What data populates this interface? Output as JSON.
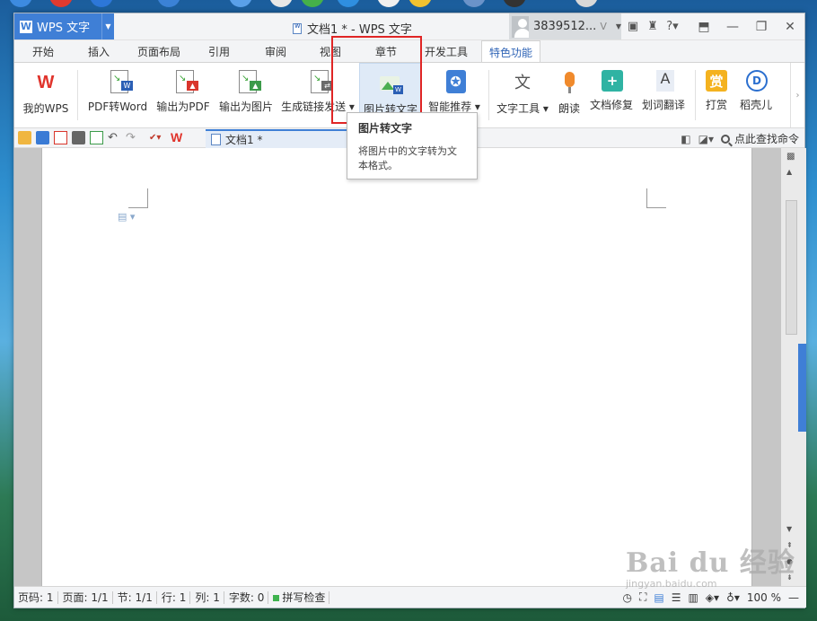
{
  "app": {
    "menu_label": "WPS 文字",
    "logo_letter": "W",
    "window_title": "文档1 * - WPS 文字",
    "user_name": "3839512...",
    "user_level": "V"
  },
  "tabs": [
    {
      "label": "开始"
    },
    {
      "label": "插入"
    },
    {
      "label": "页面布局"
    },
    {
      "label": "引用"
    },
    {
      "label": "审阅"
    },
    {
      "label": "视图"
    },
    {
      "label": "章节"
    },
    {
      "label": "开发工具"
    },
    {
      "label": "特色功能",
      "active": true
    }
  ],
  "ribbon": {
    "buttons": [
      {
        "label": "我的WPS",
        "icon": "wps-logo-icon"
      },
      {
        "label": "PDF转Word",
        "icon": "pdf-to-word-icon"
      },
      {
        "label": "输出为PDF",
        "icon": "export-pdf-icon"
      },
      {
        "label": "输出为图片",
        "icon": "export-image-icon"
      },
      {
        "label": "生成链接发送",
        "icon": "share-link-icon"
      },
      {
        "label": "图片转文字",
        "icon": "image-to-text-icon"
      },
      {
        "label": "智能推荐",
        "icon": "smart-recommend-icon"
      },
      {
        "label": "文字工具",
        "icon": "text-tools-icon"
      },
      {
        "label": "朗读",
        "icon": "microphone-icon"
      },
      {
        "label": "文档修复",
        "icon": "document-repair-icon"
      },
      {
        "label": "划词翻译",
        "icon": "translate-icon"
      },
      {
        "label": "打赏",
        "icon": "reward-icon"
      },
      {
        "label": "稻壳儿",
        "icon": "docer-icon"
      }
    ],
    "reward_glyph": "赏",
    "translate_glyph": "A"
  },
  "quick_access": {
    "document_tab": "文档1 *",
    "search_label": "点此查找命令"
  },
  "tooltip": {
    "title": "图片转文字",
    "body": "将图片中的文字转为文本格式。"
  },
  "status_bar": {
    "page_code": "页码: 1",
    "pages": "页面: 1/1",
    "section": "节: 1/1",
    "row": "行: 1",
    "col": "列: 1",
    "word_count": "字数: 0",
    "spell_check": "拼写检查",
    "zoom": "100 %"
  },
  "watermark": {
    "brand": "Bai du 经验",
    "url": "jingyan.baidu.com"
  },
  "colors": {
    "accent": "#3f7fd6",
    "highlight_frame": "#e02525"
  }
}
